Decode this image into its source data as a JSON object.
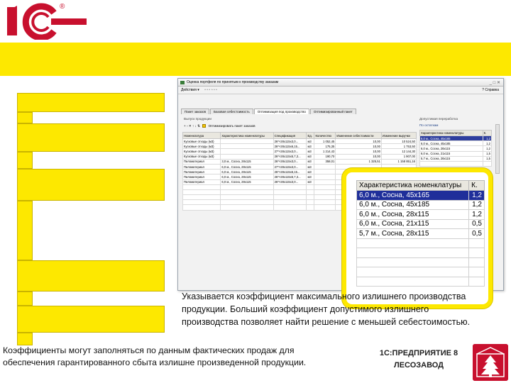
{
  "brand": {
    "logo_text": "1С",
    "registered_mark": "®",
    "product_line1": "1С:ПРЕДПРИЯТИЕ 8",
    "product_line2": "ЛЕСОЗАВОД",
    "colors": {
      "brand_red": "#c8102e",
      "accent_yellow": "#fde800",
      "selection_blue": "#1f2f9a"
    }
  },
  "window": {
    "title": "Оценка портфеля по принятым к производству заказам",
    "menu": {
      "actions": "Действия ▾",
      "help": "? Справка"
    },
    "tabs": [
      "Пакет заказов",
      "Базовая себестоимость",
      "Оптимизация под производство",
      "Оптимизированный пакет"
    ],
    "active_tab_index": 2,
    "section_title": "Выпуск продукции",
    "toolbar_label": "Оптимизировать пакет заказов",
    "table": {
      "headers": [
        "Номенклатура",
        "Характеристика номенклатуры",
        "Спецификация",
        "Ед.",
        "Количество",
        "Изменение себестоимости",
        "Изменение выручки"
      ],
      "rows": [
        [
          "Кусковые отходы (м3)",
          "",
          "26*×28х115х3,0...",
          "м3",
          "1 052,45",
          "10,00",
          "10 524,50"
        ],
        [
          "Кусковые отходы (м3)",
          "",
          "26*×28х115х6,15...",
          "м3",
          "175,35",
          "10,00",
          "1 753,50"
        ],
        [
          "Кусковые отходы (м3)",
          "",
          "27*×28х115х3,0...",
          "м3",
          "1 214,43",
          "10,00",
          "12 144,30"
        ],
        [
          "Кусковые отходы (м3)",
          "",
          "26*×28х115х5,7,3...",
          "м3",
          "190,70",
          "10,00",
          "1 907,00"
        ],
        [
          "Пиломатериал",
          "3,0 м., Сосна, 28x115",
          "26*×28х115х3,0...",
          "м3",
          "358,01",
          "1 325,51",
          "1 158 851,16"
        ],
        [
          "Пиломатериал",
          "6,0 м., Сосна, 28x115",
          "27*×28х115х3,0...",
          "м3",
          "",
          "",
          ""
        ],
        [
          "Пиломатериал",
          "6,0 м., Сосна, 28x115",
          "26*×28х115х6,15...",
          "м3",
          "",
          "",
          ""
        ],
        [
          "Пиломатериал",
          "6,0 м., Сосна, 28x115",
          "26*×28х115х5,7,3...",
          "м3",
          "",
          "",
          ""
        ],
        [
          "Пиломатериал",
          "6,0 м., Сосна, 28x115",
          "26*×28х115х3,0...",
          "м3",
          "",
          "",
          ""
        ],
        [
          "",
          "",
          "",
          "",
          "",
          "",
          ""
        ],
        [
          "",
          "",
          "",
          "",
          "",
          "",
          ""
        ],
        [
          "",
          "",
          "",
          "",
          "",
          "",
          ""
        ],
        [
          "",
          "",
          "",
          "",
          "",
          "",
          ""
        ],
        [
          "",
          "",
          "",
          "",
          "",
          "",
          ""
        ]
      ]
    },
    "right_panel": {
      "label": "Допустимая переработка",
      "link": "По остаткам",
      "headers": [
        "Характеристика номенклатуры",
        "К."
      ],
      "rows": [
        [
          "6,0 м., Сосна, 45x165",
          "1,2"
        ],
        [
          "6,0 м., Сосна, 45x185",
          "1,2"
        ],
        [
          "6,0 м., Сосна, 28x115",
          "1,2"
        ],
        [
          "6,0 м., Сосна, 21x115",
          "1,5"
        ],
        [
          "5,7 м., Сосна, 28x115",
          "1,5"
        ],
        [
          "",
          ""
        ]
      ],
      "selected_index": 0
    }
  },
  "zoom": {
    "headers": [
      "Характеристика номенклатуры",
      "К."
    ],
    "rows": [
      [
        "6,0 м., Сосна, 45x165",
        "1,2"
      ],
      [
        "6,0 м., Сосна, 45x185",
        "1,2"
      ],
      [
        "6,0 м., Сосна, 28x115",
        "1,2"
      ],
      [
        "6,0 м., Сосна, 21x115",
        "0,5"
      ],
      [
        "5,7 м., Сосна, 28x115",
        "0,5"
      ],
      [
        "",
        ""
      ],
      [
        "",
        ""
      ],
      [
        "",
        ""
      ],
      [
        "",
        ""
      ],
      [
        "",
        ""
      ]
    ],
    "selected_index": 0
  },
  "description": "Указывается коэффициент максимального излишнего производства продукции. Больший коэффициент допустимого излишнего производства позволяет найти решение с меньшей себестоимостью.",
  "footnote": "Коэффициенты могут заполняться по данным фактических продаж для обеспечения гарантированного сбыта излишне произведенной продукции."
}
